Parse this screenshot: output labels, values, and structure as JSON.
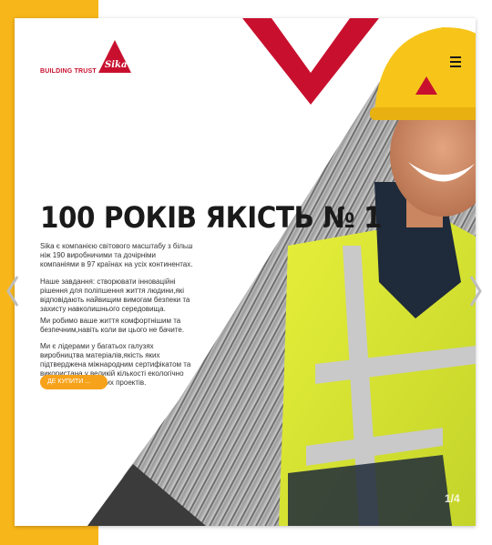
{
  "brand": {
    "tagline": "BUILDING TRUST",
    "logo_text": "Sika"
  },
  "hero": {
    "headline": "100 РОКІВ ЯКІСТЬ № 1",
    "paragraphs": [
      "Sika є компанією світового масштабу з більш ніж 190 виробничими та дочірніми компаніями в 97 країнах на усіх континентах.",
      "Наше завдання: створювати інноваційні рішення для поліпшення життя людини,які відповідають найвищим вимогам безпеки та захисту навколишнього середовища.",
      "Ми робимо ваше життя комфортнішим та безпечним,навіть коли ви цього не бачите.",
      "Ми є лідерами у багатьох галузях виробництва матеріалів,якість яких підтверджена міжнародним сертифікатом та використана у великій кількості екологічно чистих та довговічних проектів."
    ],
    "cta_label": "ДЕ КУПИТИ ..."
  },
  "slider": {
    "counter": "1/4"
  },
  "icons": {
    "menu": "hamburger-menu-icon",
    "prev": "chevron-left-icon",
    "next": "chevron-right-icon"
  },
  "colors": {
    "brand_red": "#c8102e",
    "accent_yellow": "#f7b61a",
    "cta_orange": "#f7a21b",
    "hivis_yellow": "#d9e63a"
  }
}
